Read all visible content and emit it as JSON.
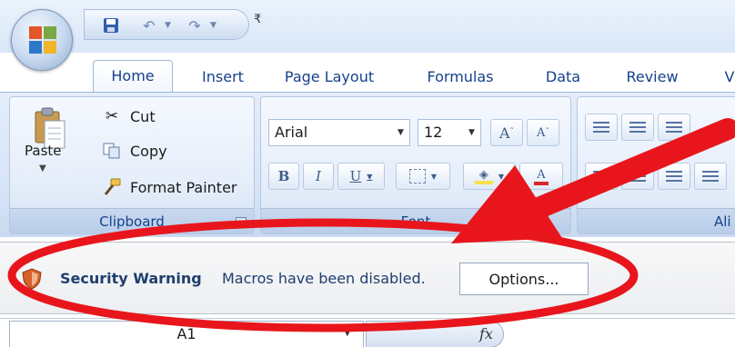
{
  "tabs": [
    "Home",
    "Insert",
    "Page Layout",
    "Formulas",
    "Data",
    "Review",
    "Vi"
  ],
  "clipboard": {
    "paste_label": "Paste",
    "cut_label": "Cut",
    "copy_label": "Copy",
    "format_painter_label": "Format Painter",
    "group_label": "Clipboard"
  },
  "font": {
    "font_name": "Arial",
    "font_size": "12",
    "group_label": "Font",
    "bold_label": "B",
    "italic_label": "I",
    "underline_label": "U",
    "grow_label": "A",
    "shrink_label": "A"
  },
  "alignment": {
    "group_label": "Ali"
  },
  "security": {
    "title": "Security Warning",
    "message": "Macros have been disabled.",
    "options_label": "Options..."
  },
  "formula_bar": {
    "name_box": "A1",
    "fx_label": "fx"
  },
  "icons": [
    "office-button-icon",
    "save-icon",
    "undo-icon",
    "redo-icon",
    "customize-qat-icon",
    "paste-icon",
    "cut-icon",
    "copy-icon",
    "format-painter-icon",
    "shield-icon",
    "fx-icon"
  ],
  "colors": {
    "ribbon_text": "#15428b",
    "annotation": "#e8161c"
  }
}
